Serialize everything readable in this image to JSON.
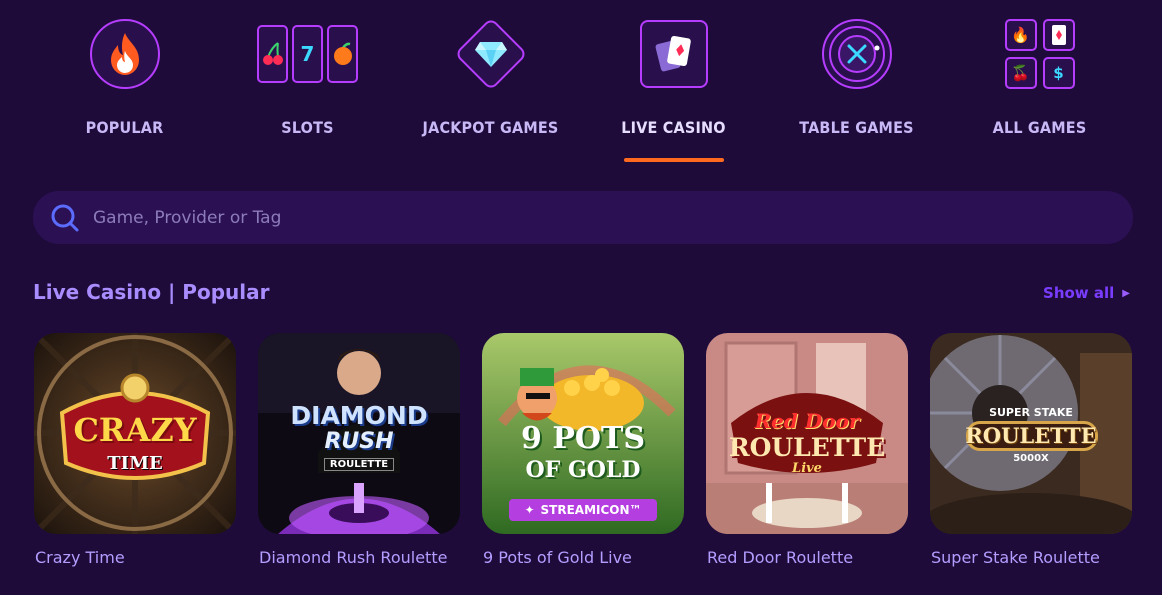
{
  "nav": {
    "items": [
      {
        "label": "POPULAR",
        "icon": "flame-icon"
      },
      {
        "label": "SLOTS",
        "icon": "slot-reels-icon",
        "reels": [
          "🍒",
          "7",
          "🍊"
        ]
      },
      {
        "label": "JACKPOT GAMES",
        "icon": "diamond-icon"
      },
      {
        "label": "LIVE CASINO",
        "icon": "playing-cards-icon",
        "active": true
      },
      {
        "label": "TABLE GAMES",
        "icon": "roulette-wheel-icon"
      },
      {
        "label": "ALL GAMES",
        "icon": "all-games-grid-icon",
        "grid": [
          "🔥",
          "♦",
          "🍒",
          "$"
        ]
      }
    ]
  },
  "search": {
    "placeholder": "Game, Provider or Tag",
    "value": ""
  },
  "section": {
    "title": "Live Casino | Popular",
    "show_all": "Show all"
  },
  "games": [
    {
      "name": "Crazy Time",
      "logo_lines": [
        "CRAZY",
        "TIME"
      ]
    },
    {
      "name": "Diamond Rush Roulette",
      "logo_lines": [
        "DIAMOND",
        "RUSH",
        "ROULETTE"
      ]
    },
    {
      "name": "9 Pots of Gold Live",
      "logo_lines": [
        "9 POTS",
        "OF GOLD"
      ],
      "badge": "STREAMICON™"
    },
    {
      "name": "Red Door Roulette",
      "logo_lines": [
        "Red Door",
        "ROULETTE",
        "Live"
      ]
    },
    {
      "name": "Super Stake Roulette",
      "logo_lines": [
        "SUPER STAKE",
        "ROULETTE",
        "5000X"
      ]
    }
  ],
  "colors": {
    "background": "#1e0b3a",
    "accent_underline": "#ff6a1f",
    "icon_border": "#b63dff",
    "title": "#a98dff",
    "show_all": "#7a3cff"
  }
}
